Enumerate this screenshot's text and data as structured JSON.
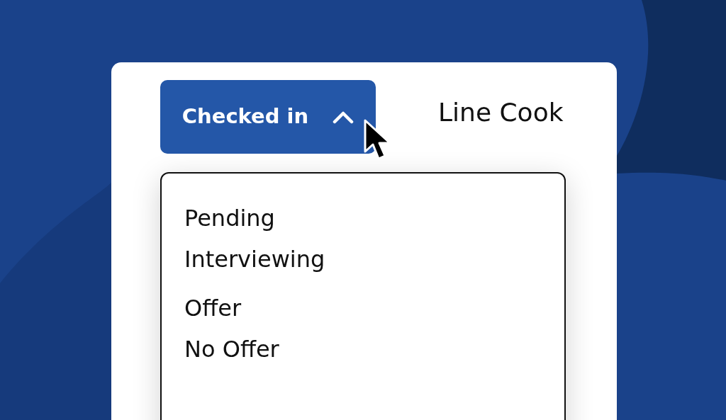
{
  "status_button": {
    "label": "Checked in",
    "expanded": true
  },
  "job_title": "Line Cook",
  "menu": {
    "items": [
      {
        "label": "Pending"
      },
      {
        "label": "Interviewing"
      },
      {
        "label": "Offer"
      },
      {
        "label": "No Offer"
      }
    ]
  }
}
